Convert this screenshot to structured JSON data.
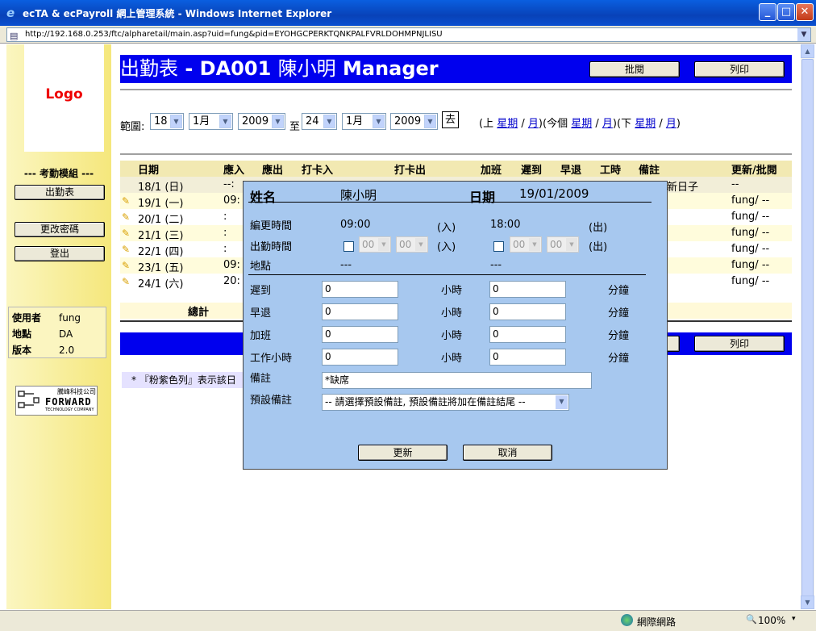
{
  "window": {
    "title": "ecTA & ecPayroll 網上管理系統 - Windows Internet Explorer",
    "url": "http://192.168.0.253/ftc/alpharetail/main.asp?uid=fung&pid=EYOHGCPERKTQNKPALFVRLDOHMPNJLISU"
  },
  "left": {
    "logo": "Logo",
    "module_label": "--- 考勤模組 ---",
    "btn_attendance": "出勤表",
    "btn_password": "更改密碼",
    "btn_logout": "登出",
    "info": [
      {
        "k": "使用者",
        "v": "fung"
      },
      {
        "k": "地點",
        "v": "DA"
      },
      {
        "k": "版本",
        "v": "2.0"
      }
    ],
    "company_cn": "騰峰科技公司",
    "company_en": "FORWARD",
    "company_sub": "TECHNOLOGY COMPANY"
  },
  "header": {
    "title_prefix": "出勤表",
    "title_code": " - DA001 ",
    "title_name": "陳小明",
    "title_role": " Manager",
    "btn_approve": "批閱",
    "btn_print": "列印"
  },
  "range": {
    "label": "範圍:",
    "from_day": "18",
    "from_month": "1月",
    "from_year": "2009",
    "to_label": "至",
    "to_day": "24",
    "to_month": "1月",
    "to_year": "2009",
    "go": "去",
    "nav_prev_open": "(上",
    "week": "星期",
    "slash": "/",
    "month": "月",
    "nav_cur_open": ")(今個",
    "nav_next_open": ")(下",
    "close": ")"
  },
  "table": {
    "headers": {
      "date": "日期",
      "in": "應入",
      "out": "應出",
      "card_in": "打卡入",
      "card_out": "打卡出",
      "ot": "加班",
      "late": "遲到",
      "early": "早退",
      "hours": "工時",
      "remark": "備註",
      "update": "更新/批閱"
    },
    "rows": [
      {
        "date": "18/1 (日)",
        "in": "--:",
        "remark": "新日子",
        "update": "--"
      },
      {
        "date": "19/1 (一)",
        "in": "09:",
        "remark": "",
        "update": "fung/ --"
      },
      {
        "date": "20/1 (二)",
        "in": ":",
        "remark": "",
        "update": "fung/ --"
      },
      {
        "date": "21/1 (三)",
        "in": ":",
        "remark": "",
        "update": "fung/ --"
      },
      {
        "date": "22/1 (四)",
        "in": ":",
        "remark": "",
        "update": "fung/ --"
      },
      {
        "date": "23/1 (五)",
        "in": "09:",
        "remark": "",
        "update": "fung/ --"
      },
      {
        "date": "24/1 (六)",
        "in": "20:",
        "remark": "",
        "update": "fung/ --"
      }
    ],
    "total": "總計"
  },
  "bottom": {
    "btn_print": "列印"
  },
  "note": "* 『粉紫色列』表示該日",
  "dialog": {
    "name_label": "姓名",
    "name_value": "陳小明",
    "date_label": "日期",
    "date_value": "19/01/2009",
    "shift_label": "編更時間",
    "shift_in": "09:00",
    "in_tag": "(入)",
    "shift_out": "18:00",
    "out_tag": "(出)",
    "attend_label": "出勤時間",
    "hh": "00",
    "mm": "00",
    "loc_label": "地點",
    "loc_in": "---",
    "loc_out": "---",
    "late_label": "遲到",
    "early_label": "早退",
    "ot_label": "加班",
    "work_label": "工作小時",
    "hour_unit": "小時",
    "min_unit": "分鐘",
    "late_h": "0",
    "late_m": "0",
    "early_h": "0",
    "early_m": "0",
    "ot_h": "0",
    "ot_m": "0",
    "work_h": "0",
    "work_m": "0",
    "remark_label": "備註",
    "remark_value": "*缺席",
    "preset_label": "預設備註",
    "preset_value": "-- 請選擇預設備註, 預設備註將加在備註結尾 --",
    "btn_update": "更新",
    "btn_cancel": "取消"
  },
  "status": {
    "zone": "網際網路",
    "zoom": "100%"
  }
}
